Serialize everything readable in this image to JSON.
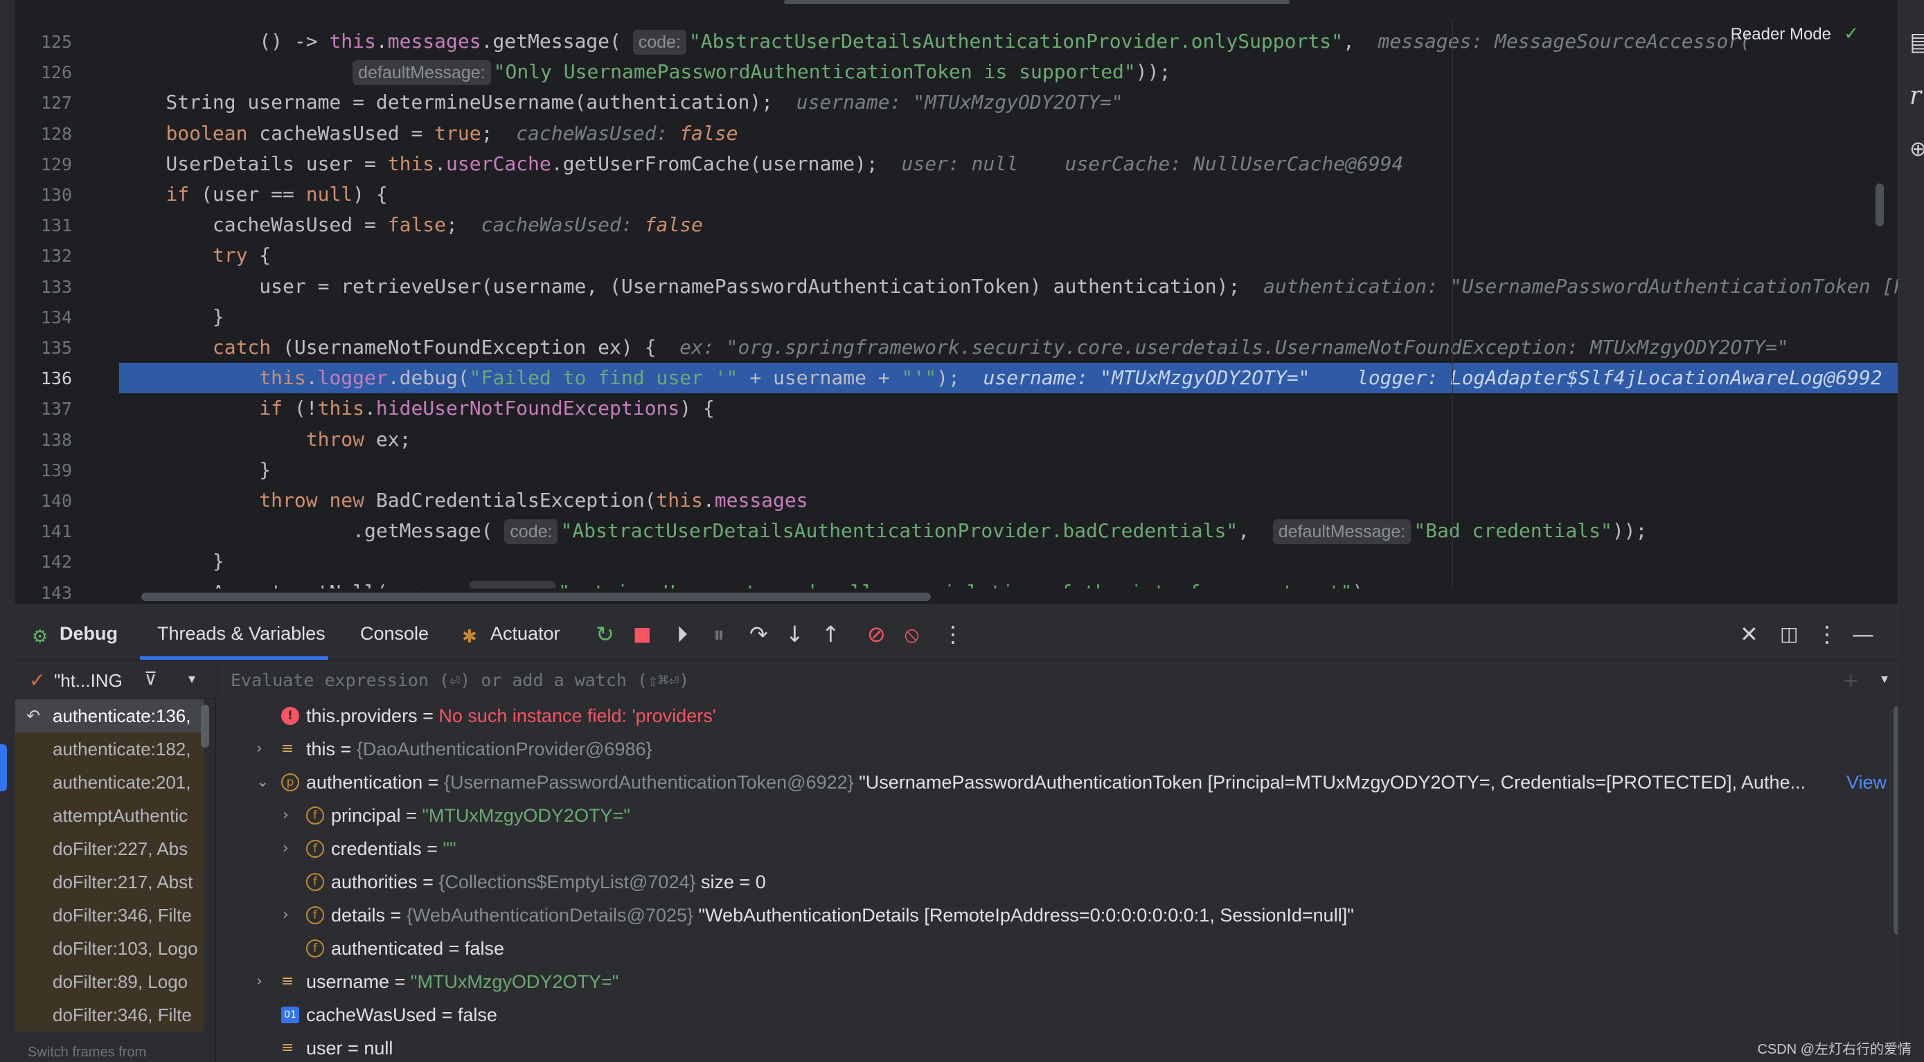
{
  "editor": {
    "lines": [
      {
        "no": "125",
        "html": "            () -> <span class=\"fld\">this</span>.<span class=\"fld\">messages</span>.getMessage( <span class=\"inl\">code:</span><span class=\"str\">\"AbstractUserDetailsAuthenticationProvider.onlySupports\"</span>,  <span class=\"hint\">messages: MessageSourceAccessor(</span>"
      },
      {
        "no": "126",
        "html": "                    <span class=\"inl\">defaultMessage:</span><span class=\"str\">\"Only UsernamePasswordAuthenticationToken is supported\"</span>));"
      },
      {
        "no": "127",
        "html": "    String username = determineUsername(authentication);  <span class=\"hint\">username: \"MTUxMzgyODY2OTY=\"</span>"
      },
      {
        "no": "128",
        "html": "    <span class=\"kw\">boolean</span> cacheWasUsed = <span class=\"kw\">true</span>;  <span class=\"hint\">cacheWasUsed: </span><span class=\"ok\">false</span>"
      },
      {
        "no": "129",
        "html": "    UserDetails user = <span class=\"kw\">this</span>.<span class=\"fld\">userCache</span>.getUserFromCache(username);  <span class=\"hint\">user: null    userCache: NullUserCache@6994</span>"
      },
      {
        "no": "130",
        "html": "    <span class=\"kw\">if</span> (user == <span class=\"kw\">null</span>) {"
      },
      {
        "no": "131",
        "html": "        cacheWasUsed = <span class=\"kw\">false</span>;  <span class=\"hint\">cacheWasUsed: </span><span class=\"ok\">false</span>"
      },
      {
        "no": "132",
        "html": "        <span class=\"kw\">try</span> {"
      },
      {
        "no": "133",
        "html": "            user = retrieveUser(username, (UsernamePasswordAuthenticationToken) authentication);  <span class=\"hint\">authentication: \"UsernamePasswordAuthenticationToken [Prin</span>"
      },
      {
        "no": "134",
        "html": "        }"
      },
      {
        "no": "135",
        "html": "        <span class=\"kw\">catch</span> (UsernameNotFoundException ex) {  <span class=\"hint\">ex: \"org.springframework.security.core.userdetails.UsernameNotFoundException: MTUxMzgyODY2OTY=\"</span>"
      },
      {
        "no": "136",
        "html": "            <span class=\"kw\">this</span>.<span class=\"fld\">logger</span>.debug(<span class=\"str\">\"Failed to find user '\"</span> + username + <span class=\"str\">\"'\"</span>);  <span class=\"hint-hl\">username: \"MTUxMzgyODY2OTY=\"    logger: LogAdapter$Slf4jLocationAwareLog@6992</span>",
        "current": true
      },
      {
        "no": "137",
        "html": "            <span class=\"kw\">if</span> (!<span class=\"kw\">this</span>.<span class=\"fld\">hideUserNotFoundExceptions</span>) {"
      },
      {
        "no": "138",
        "html": "                <span class=\"kw\">throw</span> ex;"
      },
      {
        "no": "139",
        "html": "            }"
      },
      {
        "no": "140",
        "html": "            <span class=\"kw\">throw new</span> BadCredentialsException(<span class=\"kw\">this</span>.<span class=\"fld\">messages</span>"
      },
      {
        "no": "141",
        "html": "                    .getMessage( <span class=\"inl\">code:</span><span class=\"str\">\"AbstractUserDetailsAuthenticationProvider.badCredentials\"</span>,  <span class=\"inl\">defaultMessage:</span><span class=\"str\">\"Bad credentials\"</span>));"
      },
      {
        "no": "142",
        "html": "        }"
      },
      {
        "no": "143",
        "html": "        Assert.notNull(user,  <span class=\"inl\">message:</span><span class=\"str\">\"retrieveUser returned null - a violation of the interface contract\"</span>);"
      }
    ],
    "reader_mode": "Reader Mode"
  },
  "debug": {
    "tabs": {
      "debug": "Debug",
      "threads": "Threads & Variables",
      "console": "Console",
      "actuator": "Actuator"
    },
    "thread": "\"ht...ING",
    "eval_placeholder": "Evaluate expression (⏎) or add a watch (⇧⌘⏎)",
    "frames": [
      {
        "label": "authenticate:136,",
        "sel": true
      },
      {
        "label": "authenticate:182,"
      },
      {
        "label": "authenticate:201,"
      },
      {
        "label": "attemptAuthentic"
      },
      {
        "label": "doFilter:227, Abs"
      },
      {
        "label": "doFilter:217, Abst"
      },
      {
        "label": "doFilter:346, Filte"
      },
      {
        "label": "doFilter:103, Logo"
      },
      {
        "label": "doFilter:89, Logo"
      },
      {
        "label": "doFilter:346, Filte"
      },
      {
        "label": "Switch frames from"
      }
    ],
    "vars": {
      "providers": {
        "name": "this.providers",
        "value": "No such instance field: 'providers'"
      },
      "this": {
        "name": "this",
        "type": "{DaoAuthenticationProvider@6986}"
      },
      "authentication": {
        "name": "authentication",
        "type": "{UsernamePasswordAuthenticationToken@6922}",
        "value": "\"UsernamePasswordAuthenticationToken [Principal=MTUxMzgyODY2OTY=, Credentials=[PROTECTED], Authe...",
        "link": "View"
      },
      "principal": {
        "name": "principal",
        "value": "\"MTUxMzgyODY2OTY=\""
      },
      "credentials": {
        "name": "credentials",
        "value": "\"\""
      },
      "authorities": {
        "name": "authorities",
        "type": "{Collections$EmptyList@7024}",
        "value": "size = 0"
      },
      "details": {
        "name": "details",
        "type": "{WebAuthenticationDetails@7025}",
        "value": "\"WebAuthenticationDetails [RemoteIpAddress=0:0:0:0:0:0:0:1, SessionId=null]\""
      },
      "authenticated": {
        "name": "authenticated",
        "value": "false"
      },
      "username": {
        "name": "username",
        "value": "\"MTUxMzgyODY2OTY=\""
      },
      "cacheWasUsed": {
        "name": "cacheWasUsed",
        "value": "false"
      },
      "user": {
        "name": "user",
        "value": "null"
      }
    }
  },
  "watermark": "CSDN @左灯右行的爱情"
}
